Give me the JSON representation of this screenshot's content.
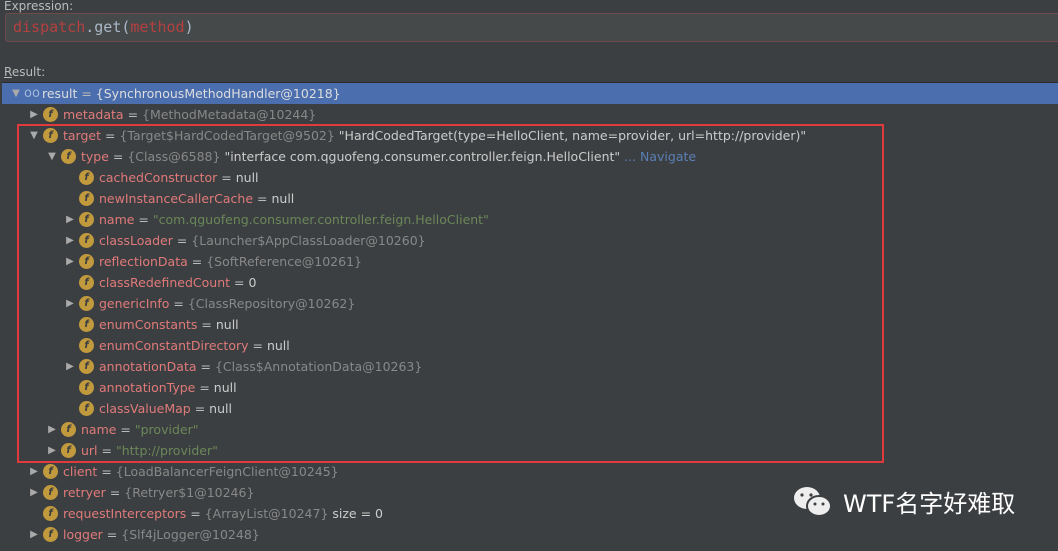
{
  "expression": {
    "label": "Expression:",
    "parts": [
      {
        "t": "dispatch",
        "c": "kw"
      },
      {
        "t": ".get(",
        "c": "pl"
      },
      {
        "t": "method",
        "c": "kw"
      },
      {
        "t": ")",
        "c": "pl"
      }
    ]
  },
  "result_label": {
    "mnemonic": "R",
    "rest": "esult:"
  },
  "rows": [
    {
      "level": 0,
      "arrow": "down",
      "icon": "watch",
      "name": "result",
      "ref": "{SynchronousMethodHandler@10218}",
      "selected": true
    },
    {
      "level": 1,
      "arrow": "right",
      "icon": "field",
      "name": "metadata",
      "ref": "{MethodMetadata@10244}"
    },
    {
      "level": 1,
      "arrow": "down",
      "icon": "field",
      "name": "target",
      "ref": "{Target$HardCodedTarget@9502}",
      "val": "\"HardCodedTarget(type=HelloClient, name=provider, url=http://provider)\""
    },
    {
      "level": 2,
      "arrow": "down",
      "icon": "field",
      "name": "type",
      "ref": "{Class@6588}",
      "val": "\"interface com.qguofeng.consumer.controller.feign.HelloClient\"",
      "nav": "... Navigate"
    },
    {
      "level": 3,
      "arrow": "none",
      "icon": "field",
      "name": "cachedConstructor",
      "val": "null"
    },
    {
      "level": 3,
      "arrow": "none",
      "icon": "field",
      "name": "newInstanceCallerCache",
      "val": "null"
    },
    {
      "level": 3,
      "arrow": "right",
      "icon": "field",
      "name": "name",
      "str": "\"com.qguofeng.consumer.controller.feign.HelloClient\""
    },
    {
      "level": 3,
      "arrow": "right",
      "icon": "field",
      "name": "classLoader",
      "ref": "{Launcher$AppClassLoader@10260}"
    },
    {
      "level": 3,
      "arrow": "right",
      "icon": "field",
      "name": "reflectionData",
      "ref": "{SoftReference@10261}"
    },
    {
      "level": 3,
      "arrow": "none",
      "icon": "field",
      "name": "classRedefinedCount",
      "val": "0"
    },
    {
      "level": 3,
      "arrow": "right",
      "icon": "field",
      "name": "genericInfo",
      "ref": "{ClassRepository@10262}"
    },
    {
      "level": 3,
      "arrow": "none",
      "icon": "field",
      "name": "enumConstants",
      "val": "null"
    },
    {
      "level": 3,
      "arrow": "none",
      "icon": "field",
      "name": "enumConstantDirectory",
      "val": "null"
    },
    {
      "level": 3,
      "arrow": "right",
      "icon": "field",
      "name": "annotationData",
      "ref": "{Class$AnnotationData@10263}"
    },
    {
      "level": 3,
      "arrow": "none",
      "icon": "field",
      "name": "annotationType",
      "val": "null"
    },
    {
      "level": 3,
      "arrow": "none",
      "icon": "field",
      "name": "classValueMap",
      "val": "null"
    },
    {
      "level": 2,
      "arrow": "right",
      "icon": "field",
      "name": "name",
      "str": "\"provider\""
    },
    {
      "level": 2,
      "arrow": "right",
      "icon": "field",
      "name": "url",
      "str": "\"http://provider\""
    },
    {
      "level": 1,
      "arrow": "right",
      "icon": "field",
      "name": "client",
      "ref": "{LoadBalancerFeignClient@10245}"
    },
    {
      "level": 1,
      "arrow": "right",
      "icon": "field",
      "name": "retryer",
      "ref": "{Retryer$1@10246}"
    },
    {
      "level": 1,
      "arrow": "none",
      "icon": "field",
      "name": "requestInterceptors",
      "ref": "{ArrayList@10247}",
      "val": " size = 0"
    },
    {
      "level": 1,
      "arrow": "right",
      "icon": "field",
      "name": "logger",
      "ref": "{Slf4jLogger@10248}"
    }
  ],
  "watermark": {
    "text": "WTF名字好难取",
    "icon": "wechat-icon"
  },
  "colors": {
    "selection": "#4b6eaf",
    "highlight_box": "#e0393e",
    "field_icon": "#c29a3e"
  }
}
